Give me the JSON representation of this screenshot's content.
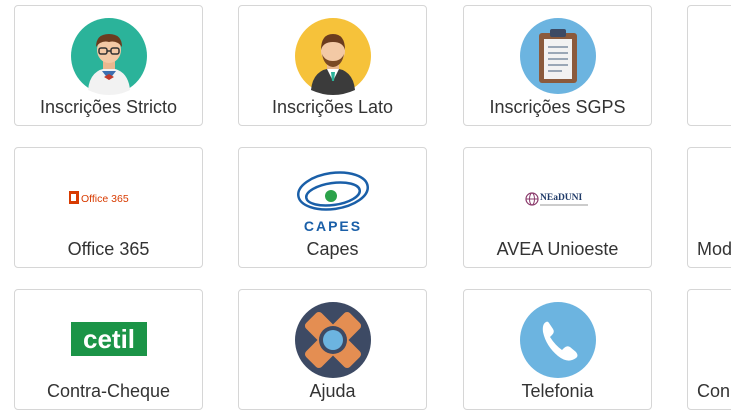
{
  "tiles": [
    {
      "label": "Inscrições Stricto",
      "icon": "student-avatar-icon"
    },
    {
      "label": "Inscrições Lato",
      "icon": "professional-avatar-icon"
    },
    {
      "label": "Inscrições SGPS",
      "icon": "clipboard-icon"
    },
    {
      "label": "",
      "icon": ""
    },
    {
      "label": "Office 365",
      "icon": "office365-logo-icon",
      "logo_text": "Office 365"
    },
    {
      "label": "Capes",
      "icon": "capes-logo-icon",
      "logo_text": "CAPES"
    },
    {
      "label": "AVEA Unioeste",
      "icon": "neaduni-logo-icon",
      "logo_text": "NEaDUNI"
    },
    {
      "label": "Mod",
      "icon": ""
    },
    {
      "label": "Contra-Cheque",
      "icon": "cetil-logo-icon",
      "logo_text": "cetil"
    },
    {
      "label": "Ajuda",
      "icon": "lifebuoy-icon"
    },
    {
      "label": "Telefonia",
      "icon": "phone-icon"
    },
    {
      "label": "Con",
      "icon": ""
    }
  ],
  "colors": {
    "teal": "#2bb39a",
    "yellow": "#f6c23a",
    "light_blue": "#6cb4e0",
    "navy": "#3d4a64",
    "orange": "#e48e52",
    "office_red": "#d83b01",
    "capes_blue": "#1a5fa8",
    "capes_green": "#2ca24a",
    "cetil_green": "#1b9447"
  }
}
